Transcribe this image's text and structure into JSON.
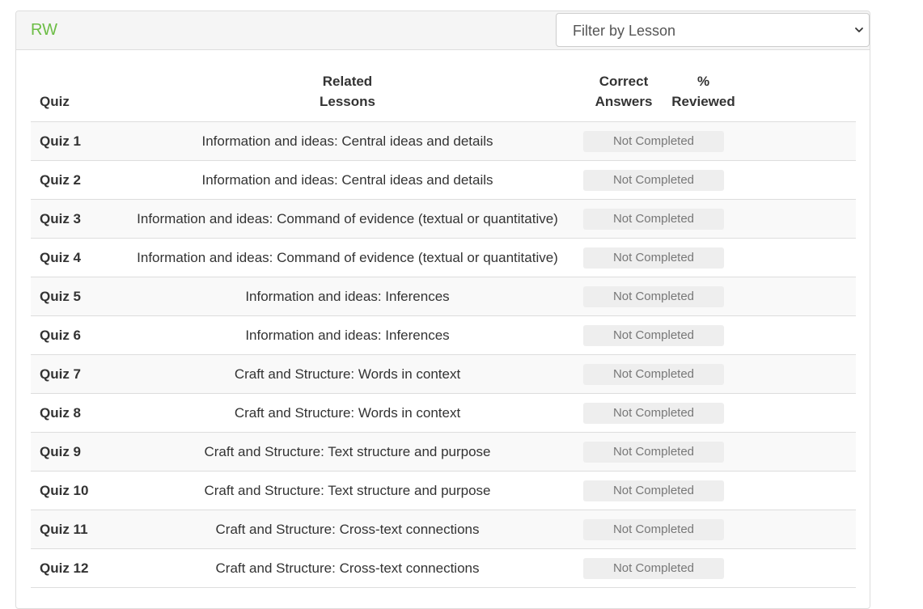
{
  "panel": {
    "title": "RW",
    "filter_label": "Filter by Lesson"
  },
  "table": {
    "headers": {
      "quiz": "Quiz",
      "lessons_line1": "Related",
      "lessons_line2": "Lessons",
      "correct_line1": "Correct",
      "correct_line2": "Answers",
      "reviewed_line1": "%",
      "reviewed_line2": "Reviewed"
    },
    "rows": [
      {
        "quiz": "Quiz 1",
        "lesson": "Information and ideas: Central ideas and details",
        "status": "Not Completed"
      },
      {
        "quiz": "Quiz 2",
        "lesson": "Information and ideas: Central ideas and details",
        "status": "Not Completed"
      },
      {
        "quiz": "Quiz 3",
        "lesson": "Information and ideas: Command of evidence (textual or quantitative)",
        "status": "Not Completed"
      },
      {
        "quiz": "Quiz 4",
        "lesson": "Information and ideas: Command of evidence (textual or quantitative)",
        "status": "Not Completed"
      },
      {
        "quiz": "Quiz 5",
        "lesson": "Information and ideas: Inferences",
        "status": "Not Completed"
      },
      {
        "quiz": "Quiz 6",
        "lesson": "Information and ideas: Inferences",
        "status": "Not Completed"
      },
      {
        "quiz": "Quiz 7",
        "lesson": "Craft and Structure: Words in context",
        "status": "Not Completed"
      },
      {
        "quiz": "Quiz 8",
        "lesson": "Craft and Structure: Words in context",
        "status": "Not Completed"
      },
      {
        "quiz": "Quiz 9",
        "lesson": "Craft and Structure: Text structure and purpose",
        "status": "Not Completed"
      },
      {
        "quiz": "Quiz 10",
        "lesson": "Craft and Structure: Text structure and purpose",
        "status": "Not Completed"
      },
      {
        "quiz": "Quiz 11",
        "lesson": "Craft and Structure: Cross-text connections",
        "status": "Not Completed"
      },
      {
        "quiz": "Quiz 12",
        "lesson": "Craft and Structure: Cross-text connections",
        "status": "Not Completed"
      }
    ]
  },
  "colors": {
    "title_green": "#6cbd45",
    "badge_bg": "#eeeeee",
    "badge_text": "#777777"
  }
}
